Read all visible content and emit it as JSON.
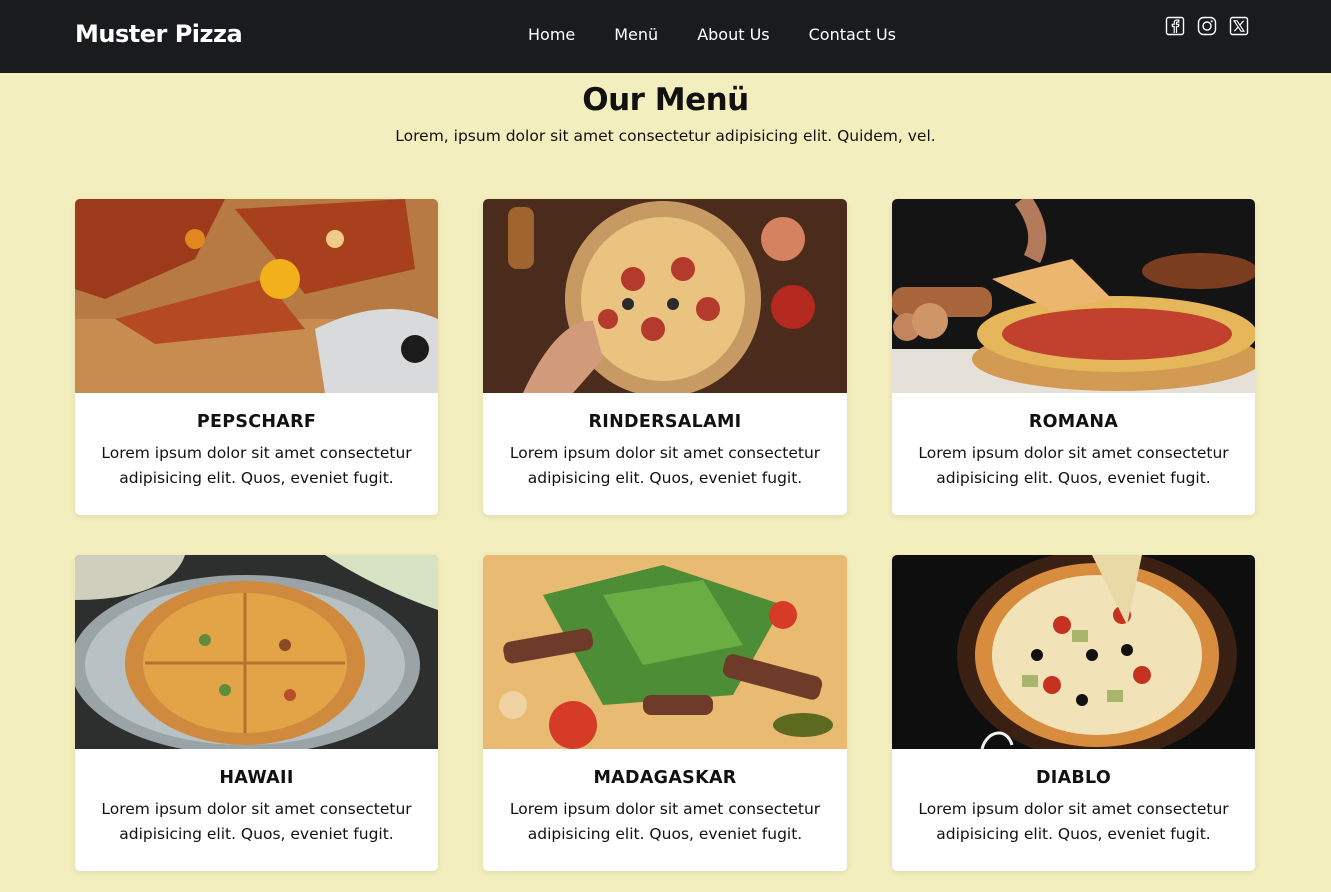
{
  "header": {
    "brand": "Muster Pizza",
    "nav": [
      "Home",
      "Menü",
      "About Us",
      "Contact Us"
    ],
    "social_icons": [
      "facebook-icon",
      "instagram-icon",
      "x-icon"
    ]
  },
  "hero": {
    "title": "Our Menü",
    "subtitle": "Lorem, ipsum dolor sit amet consectetur adipisicing elit. Quidem, vel."
  },
  "menu": {
    "items": [
      {
        "name": "PEPSCHARF",
        "desc": "Lorem ipsum dolor sit amet consectetur adipisicing elit. Quos, eveniet fugit."
      },
      {
        "name": "RINDERSALAMI",
        "desc": "Lorem ipsum dolor sit amet consectetur adipisicing elit. Quos, eveniet fugit."
      },
      {
        "name": "ROMANA",
        "desc": "Lorem ipsum dolor sit amet consectetur adipisicing elit. Quos, eveniet fugit."
      },
      {
        "name": "HAWAII",
        "desc": "Lorem ipsum dolor sit amet consectetur adipisicing elit. Quos, eveniet fugit."
      },
      {
        "name": "MADAGASKAR",
        "desc": "Lorem ipsum dolor sit amet consectetur adipisicing elit. Quos, eveniet fugit."
      },
      {
        "name": "DIABLO",
        "desc": "Lorem ipsum dolor sit amet consectetur adipisicing elit. Quos, eveniet fugit."
      }
    ]
  },
  "colors": {
    "header_bg": "#1a1b1d",
    "page_bg": "#f3eebd",
    "card_bg": "#ffffff"
  }
}
